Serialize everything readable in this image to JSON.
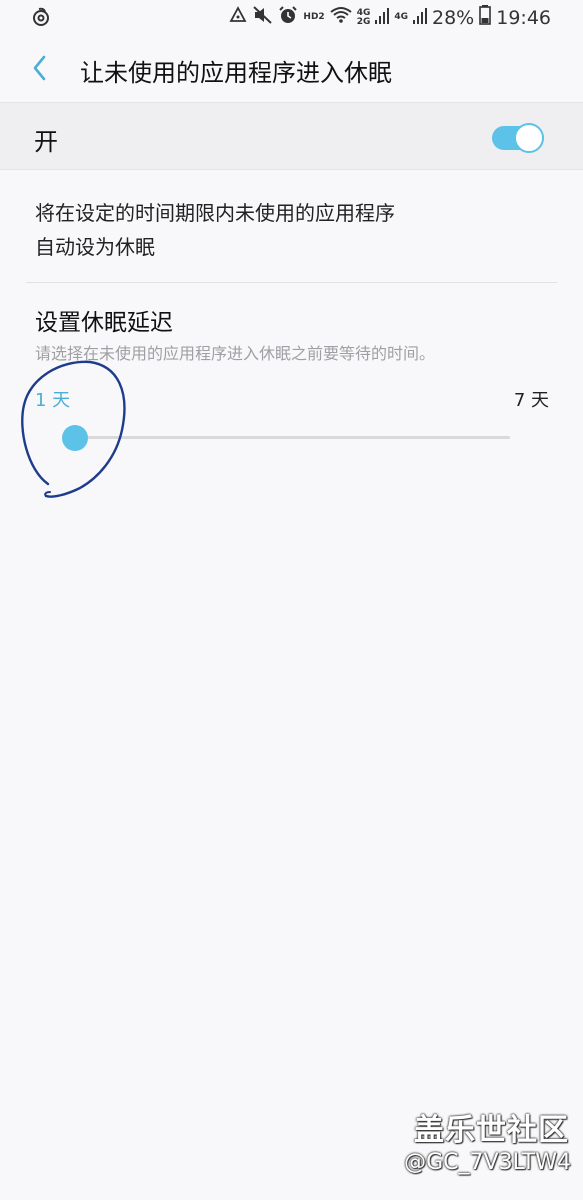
{
  "status_bar": {
    "battery_percent": "28%",
    "time": "19:46",
    "hd_label": "HD2",
    "net_label_1": "4G",
    "net_label_2": "2G",
    "net_label_3": "4G",
    "icons": [
      "app-notification-icon",
      "recycle-icon",
      "mute-icon",
      "alarm-icon",
      "wifi-icon",
      "signal-icon",
      "battery-icon"
    ]
  },
  "header": {
    "title": "让未使用的应用程序进入休眠",
    "back_icon": "chevron-left-icon"
  },
  "master_toggle": {
    "label": "开",
    "state": true
  },
  "description": {
    "line1": "将在设定的时间期限内未使用的应用程序",
    "line2": "自动设为休眠"
  },
  "sleep_delay": {
    "title": "设置休眠延迟",
    "subtitle": "请选择在未使用的应用程序进入休眠之前要等待的时间。",
    "min_label": "1 天",
    "max_label": "7 天",
    "value_fraction": 0.0
  },
  "watermark": {
    "brand": "盖乐世社区",
    "handle": "@GC_7V3LTW4"
  },
  "colors": {
    "accent": "#5cc2e8",
    "background": "#f8f8fa",
    "annotation_ink": "#1e3c8c"
  }
}
